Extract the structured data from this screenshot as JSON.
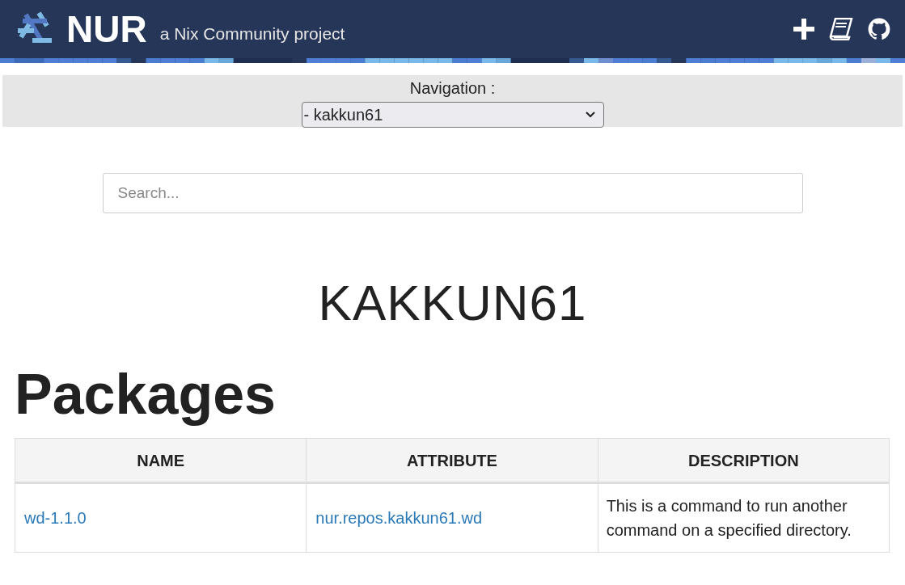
{
  "header": {
    "logo": "NUR",
    "tagline": "a Nix Community project"
  },
  "navigation": {
    "label": "Navigation :",
    "value": "- kakkun61"
  },
  "search": {
    "placeholder": "Search..."
  },
  "repo_title": "KAKKUN61",
  "section_title": "Packages",
  "table": {
    "columns": [
      "NAME",
      "ATTRIBUTE",
      "DESCRIPTION"
    ],
    "rows": [
      {
        "name": "wd-1.1.0",
        "attribute": "nur.repos.kakkun61.wd",
        "description": "This is a command to run another command on a specified directory."
      }
    ]
  }
}
